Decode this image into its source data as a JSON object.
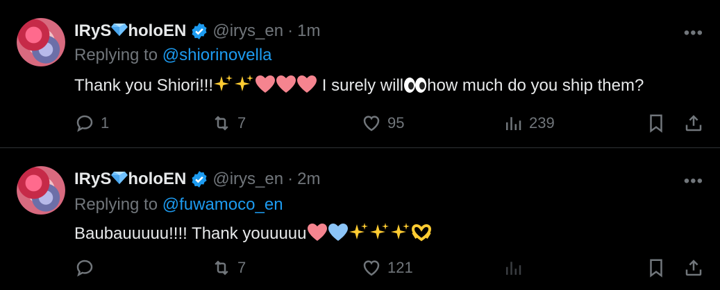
{
  "tweets": [
    {
      "display_name": "IRyS",
      "display_suffix": "holoEN",
      "handle": "@irys_en",
      "separator": "·",
      "time": "1m",
      "replying_prefix": "Replying to",
      "replying_to": "@shiorinovella",
      "text_a": "Thank you Shiori!!!",
      "text_b": " I surely will",
      "text_c": "how much do you ship them?",
      "reply_count": "1",
      "retweet_count": "7",
      "like_count": "95",
      "view_count": "239"
    },
    {
      "display_name": "IRyS",
      "display_suffix": "holoEN",
      "handle": "@irys_en",
      "separator": "·",
      "time": "2m",
      "replying_prefix": "Replying to",
      "replying_to": "@fuwamoco_en",
      "text_a": "Baubauuuuu!!!! Thank youuuuu",
      "reply_count": "",
      "retweet_count": "7",
      "like_count": "121",
      "view_count": ""
    }
  ],
  "icons": {
    "more": "more-dots-icon",
    "reply": "reply-icon",
    "retweet": "retweet-icon",
    "like": "heart-icon",
    "views": "views-icon",
    "bookmark": "bookmark-icon",
    "share": "share-icon"
  },
  "colors": {
    "link": "#1d9bf0",
    "muted": "#71767b",
    "text": "#e7e9ea",
    "pink_heart": "#f5848f",
    "blue_heart": "#8bc4f7",
    "sparkle": "#ffcc32"
  }
}
